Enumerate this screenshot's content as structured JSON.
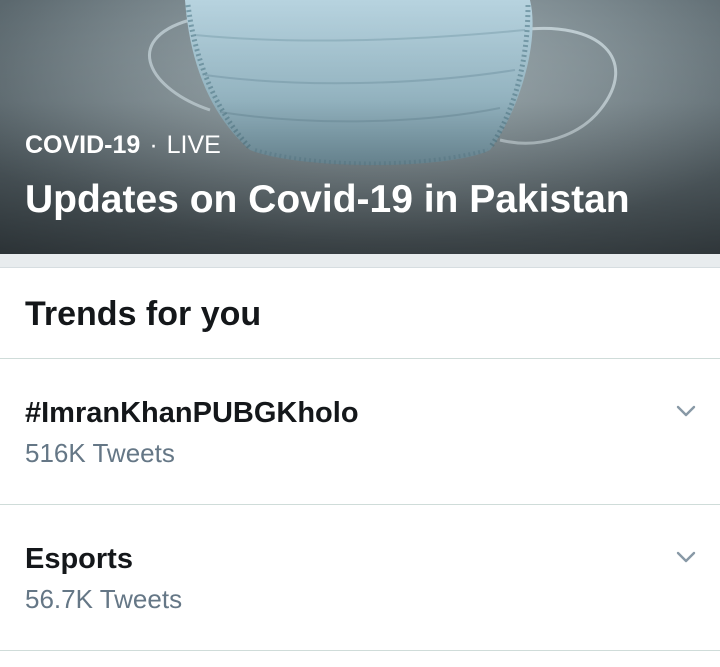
{
  "hero": {
    "category": "COVID-19",
    "separator": "·",
    "status": "LIVE",
    "title": "Updates on Covid-19 in Pakistan"
  },
  "trends_section": {
    "title": "Trends for you",
    "items": [
      {
        "name": "#ImranKhanPUBGKholo",
        "count": "516K Tweets"
      },
      {
        "name": "Esports",
        "count": "56.7K Tweets"
      }
    ]
  },
  "icons": {
    "more": "chevron-down-icon"
  },
  "colors": {
    "text_primary": "#14171a",
    "text_secondary": "#657786",
    "divider": "#cfdcd9",
    "hero_text": "#ffffff"
  }
}
